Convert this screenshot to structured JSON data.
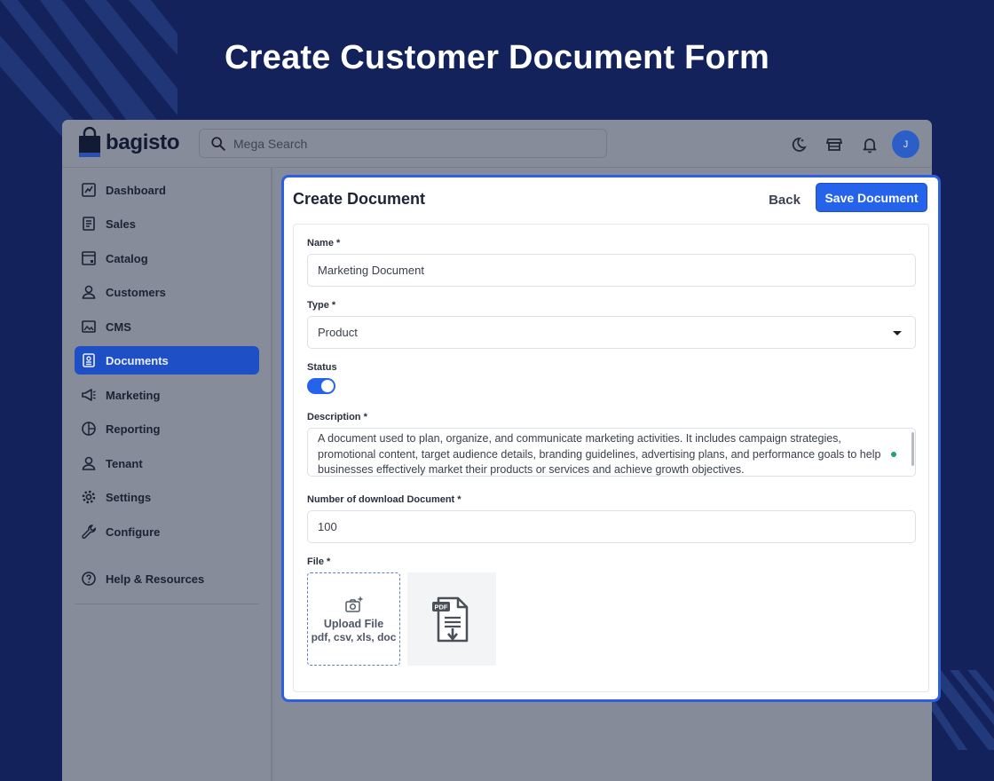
{
  "headline": "Create Customer Document Form",
  "brand": {
    "name": "bagisto",
    "accent": "#2563eb"
  },
  "topbar": {
    "search_placeholder": "Mega Search",
    "avatar_initial": "J",
    "icons": [
      "theme-toggle-icon",
      "storefront-icon",
      "notification-bell-icon"
    ]
  },
  "sidebar": {
    "items": [
      {
        "label": "Dashboard",
        "icon": "dashboard-icon"
      },
      {
        "label": "Sales",
        "icon": "sales-icon"
      },
      {
        "label": "Catalog",
        "icon": "catalog-icon"
      },
      {
        "label": "Customers",
        "icon": "customers-icon"
      },
      {
        "label": "CMS",
        "icon": "cms-icon"
      },
      {
        "label": "Documents",
        "icon": "documents-icon",
        "active": true
      },
      {
        "label": "Marketing",
        "icon": "marketing-icon"
      },
      {
        "label": "Reporting",
        "icon": "reporting-icon"
      },
      {
        "label": "Tenant",
        "icon": "tenant-icon"
      },
      {
        "label": "Settings",
        "icon": "settings-icon"
      },
      {
        "label": "Configure",
        "icon": "configure-icon"
      }
    ],
    "help_label": "Help & Resources"
  },
  "form": {
    "title": "Create Document",
    "back_label": "Back",
    "save_label": "Save Document",
    "name_label": "Name *",
    "name_value": "Marketing Document",
    "type_label": "Type *",
    "type_value": "Product",
    "status_label": "Status",
    "status_on": true,
    "description_label": "Description *",
    "description_value": "A document used to plan, organize, and communicate marketing activities. It includes campaign strategies, promotional content, target audience details, branding guidelines, advertising plans, and performance goals to help businesses effectively market their products or services and achieve growth objectives.",
    "downloads_label": "Number of download Document *",
    "downloads_value": "100",
    "file_label": "File *",
    "upload_title": "Upload File",
    "upload_formats": "pdf, csv, xls, doc",
    "preview_icon": "pdf-file-icon"
  }
}
